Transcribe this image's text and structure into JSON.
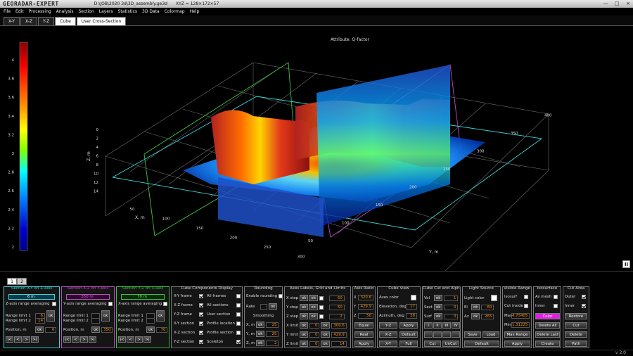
{
  "app": {
    "logo": "GEORADAR-EXPERT",
    "path": "D:\\JOB\\2020 3d\\3D_assembly.ge3d",
    "dims": "XYZ = 128×172×57",
    "version": "v 2.0"
  },
  "window_buttons": [
    "—",
    "□",
    "×"
  ],
  "menu": [
    "File",
    "Edit",
    "Processing",
    "Analysis",
    "Section",
    "Layers",
    "Statistics",
    "3D Data",
    "Colormap",
    "Help"
  ],
  "view_tabs": [
    {
      "label": "X-Y",
      "active": false
    },
    {
      "label": "X-Z",
      "active": false
    },
    {
      "label": "Y-Z",
      "active": false
    },
    {
      "label": "Cube",
      "active": true
    },
    {
      "label": "User Cross-Section",
      "active": false
    }
  ],
  "plot": {
    "title": "Attribute: Q-factor",
    "colorbar_ticks": [
      "4",
      "3.8",
      "3.6",
      "3.4",
      "3.2",
      "3",
      "2.8",
      "2.6",
      "2.4",
      "2.2",
      "2"
    ],
    "colors": [
      "#8b0000",
      "#ff0000",
      "#ff8c00",
      "#ffff00",
      "#7fff00",
      "#00ffff",
      "#0080ff",
      "#0000cd",
      "#00008b"
    ],
    "z_ticks": [
      "0",
      "2",
      "4",
      "6",
      "8",
      "10",
      "12",
      "14"
    ],
    "z_label": "Z, m",
    "x_ticks": [
      "50",
      "100",
      "150",
      "200",
      "250",
      "300"
    ],
    "x_label": "X, m",
    "y_ticks": [
      "50",
      "100",
      "150",
      "200",
      "250",
      "300",
      "350",
      "400"
    ],
    "y_label": "Y, m"
  },
  "pause_icon": "pause",
  "page_tabs": [
    "1",
    "2"
  ],
  "sec_xy": {
    "title": "Section X-Y on Z-axis",
    "value": "6 m",
    "range_avg": "Z-axis range averaging",
    "limit1_label": "Range limit 1",
    "limit2_label": "Range limit 2",
    "limit1": "6",
    "limit2": "14",
    "pos_label": "Position, m",
    "pos": "6",
    "ok": "ok",
    "nav": [
      "|<",
      "<",
      ">",
      ">|"
    ]
  },
  "sec_xz": {
    "title": "Section X-Z on Y-axis",
    "value": "350 m",
    "range_avg": "Y-axis range averaging",
    "limit1_label": "Range limit 1",
    "limit2_label": "Range limit 2",
    "pos_label": "Position, m",
    "pos": "350",
    "ok": "ok",
    "nav": [
      "|<",
      "<",
      ">",
      ">|"
    ]
  },
  "sec_yz": {
    "title": "Section Y-Z on X-axis",
    "value": "70 m",
    "range_avg": "X-axis range averaging",
    "limit1_label": "Range limit 1",
    "limit2_label": "Range limit 2",
    "pos_label": "Position, m",
    "pos": "70",
    "ok": "ok",
    "nav": [
      "|<",
      "<",
      ">",
      ">|"
    ]
  },
  "components": {
    "title": "Cube Components Display",
    "left": [
      "X-Y frame",
      "X-Z frame",
      "Y-Z frame",
      "X-Y section",
      "X-Z section",
      "Y-Z section"
    ],
    "right": [
      "All frames",
      "All sections",
      "User section",
      "Profile location",
      "Profile section",
      "Sceleton"
    ]
  },
  "rounding": {
    "title": "Rounding",
    "enable": "Enable rounding",
    "rate_label": "Rate",
    "smooth_title": "Smoothing",
    "x_label": "X, m",
    "y_label": "Y, m",
    "z_label": "Z, m",
    "x": "25",
    "y": "25",
    "z": "2"
  },
  "axes": {
    "title": "Axes Labels, Grid and Limits",
    "rows": [
      {
        "label": "X step",
        "v": "50"
      },
      {
        "label": "Y step",
        "v": "50"
      },
      {
        "label": "Z step",
        "v": "2"
      },
      {
        "label": "X limit",
        "v1": "0",
        "v2": "300.6"
      },
      {
        "label": "Y limit",
        "v1": "0",
        "v2": "429.9"
      },
      {
        "label": "Z limit",
        "v1": "0",
        "v2": "14"
      }
    ],
    "btn": "ok"
  },
  "ratio": {
    "title": "Axis Ratio",
    "rows": [
      "X",
      "Y",
      "Z"
    ],
    "vals": [
      "320.6",
      "429.9",
      "50"
    ],
    "equal": "Equal",
    "real": "Real",
    "apply": "Apply"
  },
  "cubeview": {
    "title": "Cube View",
    "axes_color": "Axes color",
    "elev_label": "Elevation, deg",
    "elev": "17",
    "azim_label": "Azimuth, deg",
    "azim": "38",
    "btns": [
      "Y-Z",
      "Apply",
      "X-Z",
      "Default",
      "X-Y",
      "Full"
    ]
  },
  "cut": {
    "title": "Cube Cut and Alpha",
    "labels": [
      "Vol",
      "Sect",
      "Surf"
    ],
    "vals": [
      "1",
      "0",
      "0"
    ],
    "roman": [
      "I",
      "II",
      "III",
      "IV"
    ],
    "cut": "Cut",
    "uncut": "UnCut",
    "ok": "ok"
  },
  "light": {
    "title": "Light Source",
    "light_color": "Light color",
    "el_label": "El",
    "el": "60",
    "az_label": "Az",
    "az": "265",
    "save": "Save",
    "load": "Load",
    "default": "Default",
    "ok": "ok"
  },
  "vrange": {
    "title": "Visible Range",
    "isosurf": "Isosurf",
    "cut_inside": "Cut inside",
    "max_label": "Max",
    "max": "4.75405",
    "min_label": "Min",
    "min": "1.31225",
    "max_range": "Max Range",
    "apply": "Apply"
  },
  "iso": {
    "title": "Isosurface",
    "as_mesh": "As mesh",
    "inner": "Inner",
    "color": "Color",
    "delete_all": "Delete All",
    "delete_last": "Delete Last",
    "create": "Create"
  },
  "cutarea": {
    "title": "Cut Area",
    "outer": "Outer",
    "inner": "Inner",
    "restore": "Restore",
    "cut": "Cut",
    "delete": "Delete",
    "path": "Path"
  }
}
